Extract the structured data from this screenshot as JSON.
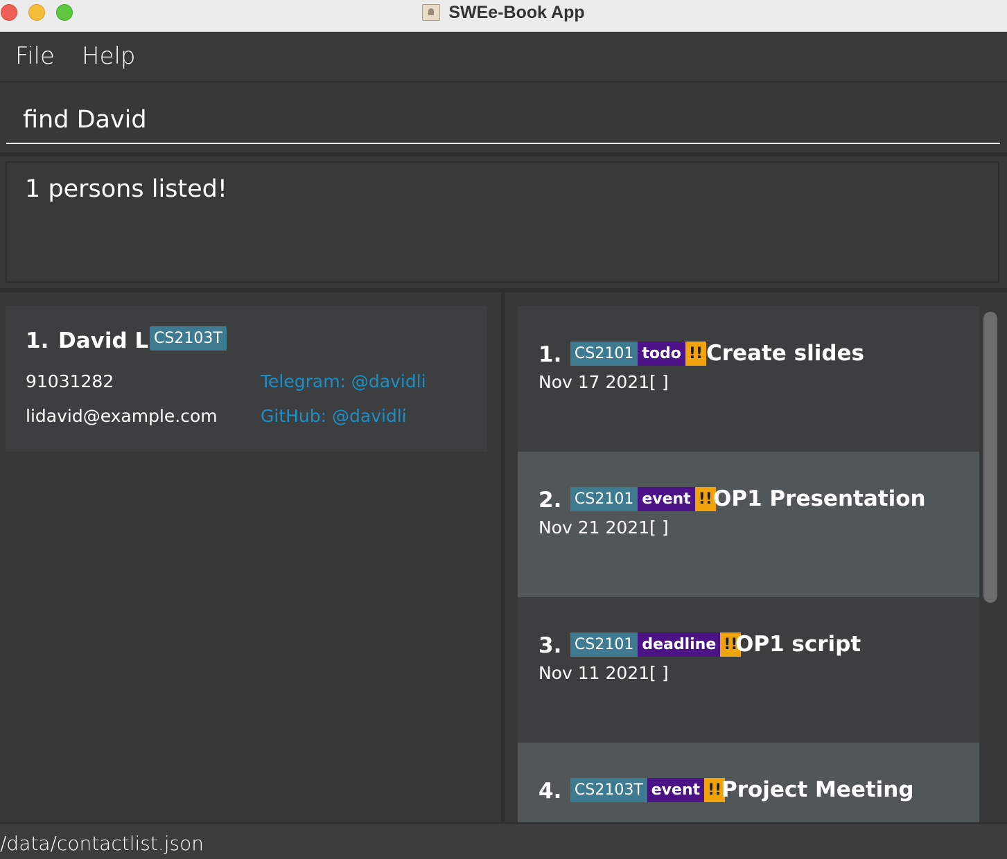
{
  "window": {
    "title": "SWEe-Book App"
  },
  "menu": {
    "file": "File",
    "help": "Help"
  },
  "command": {
    "value": "find David"
  },
  "result": {
    "text": "1 persons listed!"
  },
  "persons": [
    {
      "index": "1.",
      "name": "David Li",
      "tag": "CS2103T",
      "phone": "91031282",
      "email": "lidavid@example.com",
      "telegram": "Telegram: @davidli",
      "github": "GitHub: @davidli"
    }
  ],
  "tasks": [
    {
      "index": "1.",
      "module": "CS2101",
      "type": "todo",
      "priority": "!!",
      "title": "Create slides",
      "date": "Nov 17 2021[ ]"
    },
    {
      "index": "2.",
      "module": "CS2101",
      "type": "event",
      "priority": "!!",
      "title": "OP1 Presentation",
      "date": "Nov 21 2021[ ]"
    },
    {
      "index": "3.",
      "module": "CS2101",
      "type": "deadline",
      "priority": "!!",
      "title": "OP1 script",
      "date": "Nov 11 2021[ ]"
    },
    {
      "index": "4.",
      "module": "CS2103T",
      "type": "event",
      "priority": "!!",
      "title": "Project Meeting",
      "date": ""
    }
  ],
  "status": {
    "path": "/data/contactlist.json"
  },
  "colors": {
    "module_tag": "#3e7b91",
    "type_tag": "#4b1386",
    "priority_tag": "#f0a30a",
    "link": "#1e8fc6",
    "background": "#383838"
  }
}
